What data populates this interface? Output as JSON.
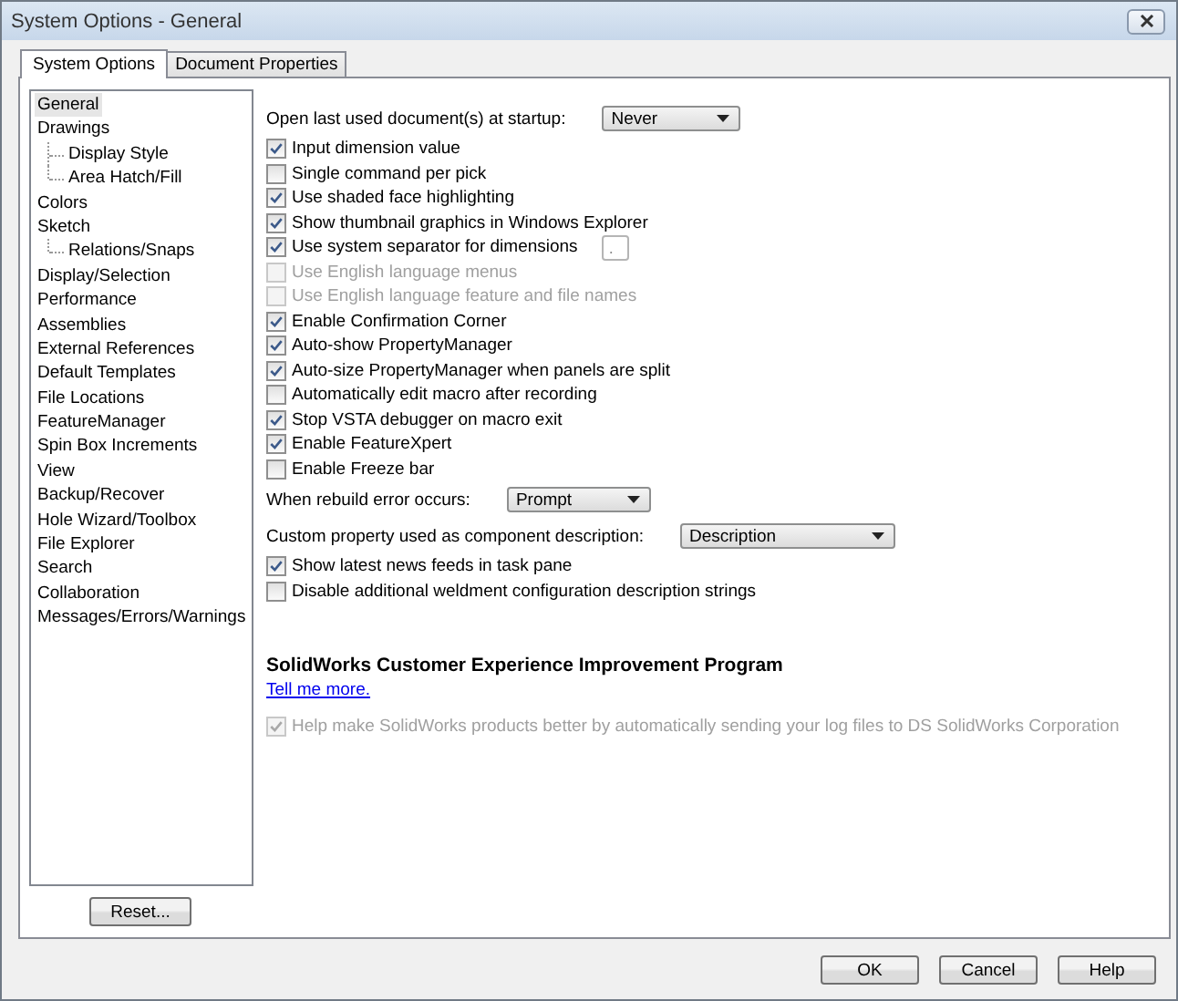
{
  "window": {
    "title": "System Options - General"
  },
  "tabs": [
    {
      "label": "System Options",
      "selected": true
    },
    {
      "label": "Document Properties",
      "selected": false
    }
  ],
  "sidebar": {
    "items": [
      {
        "label": "General",
        "selected": true
      },
      {
        "label": "Drawings",
        "selected": false,
        "children": [
          {
            "label": "Display Style",
            "selected": false
          },
          {
            "label": "Area Hatch/Fill",
            "selected": false
          }
        ]
      },
      {
        "label": "Colors",
        "selected": false
      },
      {
        "label": "Sketch",
        "selected": false,
        "children": [
          {
            "label": "Relations/Snaps",
            "selected": false
          }
        ]
      },
      {
        "label": "Display/Selection",
        "selected": false
      },
      {
        "label": "Performance",
        "selected": false
      },
      {
        "label": "Assemblies",
        "selected": false
      },
      {
        "label": "External References",
        "selected": false
      },
      {
        "label": "Default Templates",
        "selected": false
      },
      {
        "label": "File Locations",
        "selected": false
      },
      {
        "label": "FeatureManager",
        "selected": false
      },
      {
        "label": "Spin Box Increments",
        "selected": false
      },
      {
        "label": "View",
        "selected": false
      },
      {
        "label": "Backup/Recover",
        "selected": false
      },
      {
        "label": "Hole Wizard/Toolbox",
        "selected": false
      },
      {
        "label": "File Explorer",
        "selected": false
      },
      {
        "label": "Search",
        "selected": false
      },
      {
        "label": "Collaboration",
        "selected": false
      },
      {
        "label": "Messages/Errors/Warnings",
        "selected": false
      }
    ],
    "reset_button": "Reset..."
  },
  "options": [
    {
      "kind": "dropdown",
      "label": "Open last used document(s) at startup:",
      "value": "Never"
    },
    {
      "kind": "checkbox",
      "label": "Input dimension value",
      "checked": true,
      "disabled": false
    },
    {
      "kind": "checkbox",
      "label": "Single command per pick",
      "checked": false,
      "disabled": false
    },
    {
      "kind": "checkbox",
      "label": "Use shaded face highlighting",
      "checked": true,
      "disabled": false
    },
    {
      "kind": "checkbox",
      "label": "Show thumbnail graphics in Windows Explorer",
      "checked": true,
      "disabled": false
    },
    {
      "kind": "checkbox",
      "label": "Use system separator for dimensions",
      "checked": true,
      "disabled": false,
      "field_value": "."
    },
    {
      "kind": "checkbox",
      "label": "Use English language menus",
      "checked": false,
      "disabled": true
    },
    {
      "kind": "checkbox",
      "label": "Use English language feature and file names",
      "checked": false,
      "disabled": true
    },
    {
      "kind": "checkbox",
      "label": "Enable Confirmation Corner",
      "checked": true,
      "disabled": false
    },
    {
      "kind": "checkbox",
      "label": "Auto-show PropertyManager",
      "checked": true,
      "disabled": false
    },
    {
      "kind": "checkbox",
      "label": "Auto-size PropertyManager when panels are split",
      "checked": true,
      "disabled": false
    },
    {
      "kind": "checkbox",
      "label": "Automatically edit macro after recording",
      "checked": false,
      "disabled": false
    },
    {
      "kind": "checkbox",
      "label": "Stop VSTA debugger on macro exit",
      "checked": true,
      "disabled": false
    },
    {
      "kind": "checkbox",
      "label": "Enable FeatureXpert",
      "checked": true,
      "disabled": false
    },
    {
      "kind": "checkbox",
      "label": "Enable Freeze bar",
      "checked": false,
      "disabled": false
    },
    {
      "kind": "dropdown",
      "label": "When rebuild error occurs:",
      "value": "Prompt"
    },
    {
      "kind": "dropdown",
      "label": "Custom property used as component description:",
      "value": "Description"
    },
    {
      "kind": "checkbox",
      "label": "Show latest news feeds in task pane",
      "checked": true,
      "disabled": false
    },
    {
      "kind": "checkbox",
      "label": "Disable additional weldment configuration description strings",
      "checked": false,
      "disabled": false
    }
  ],
  "ceip": {
    "heading": "SolidWorks Customer Experience Improvement Program",
    "link": "Tell me more.",
    "option": {
      "label": "Help make SolidWorks products better by automatically sending your log files to DS SolidWorks Corporation",
      "checked": true,
      "disabled": true
    }
  },
  "buttons": [
    "OK",
    "Cancel",
    "Help"
  ]
}
